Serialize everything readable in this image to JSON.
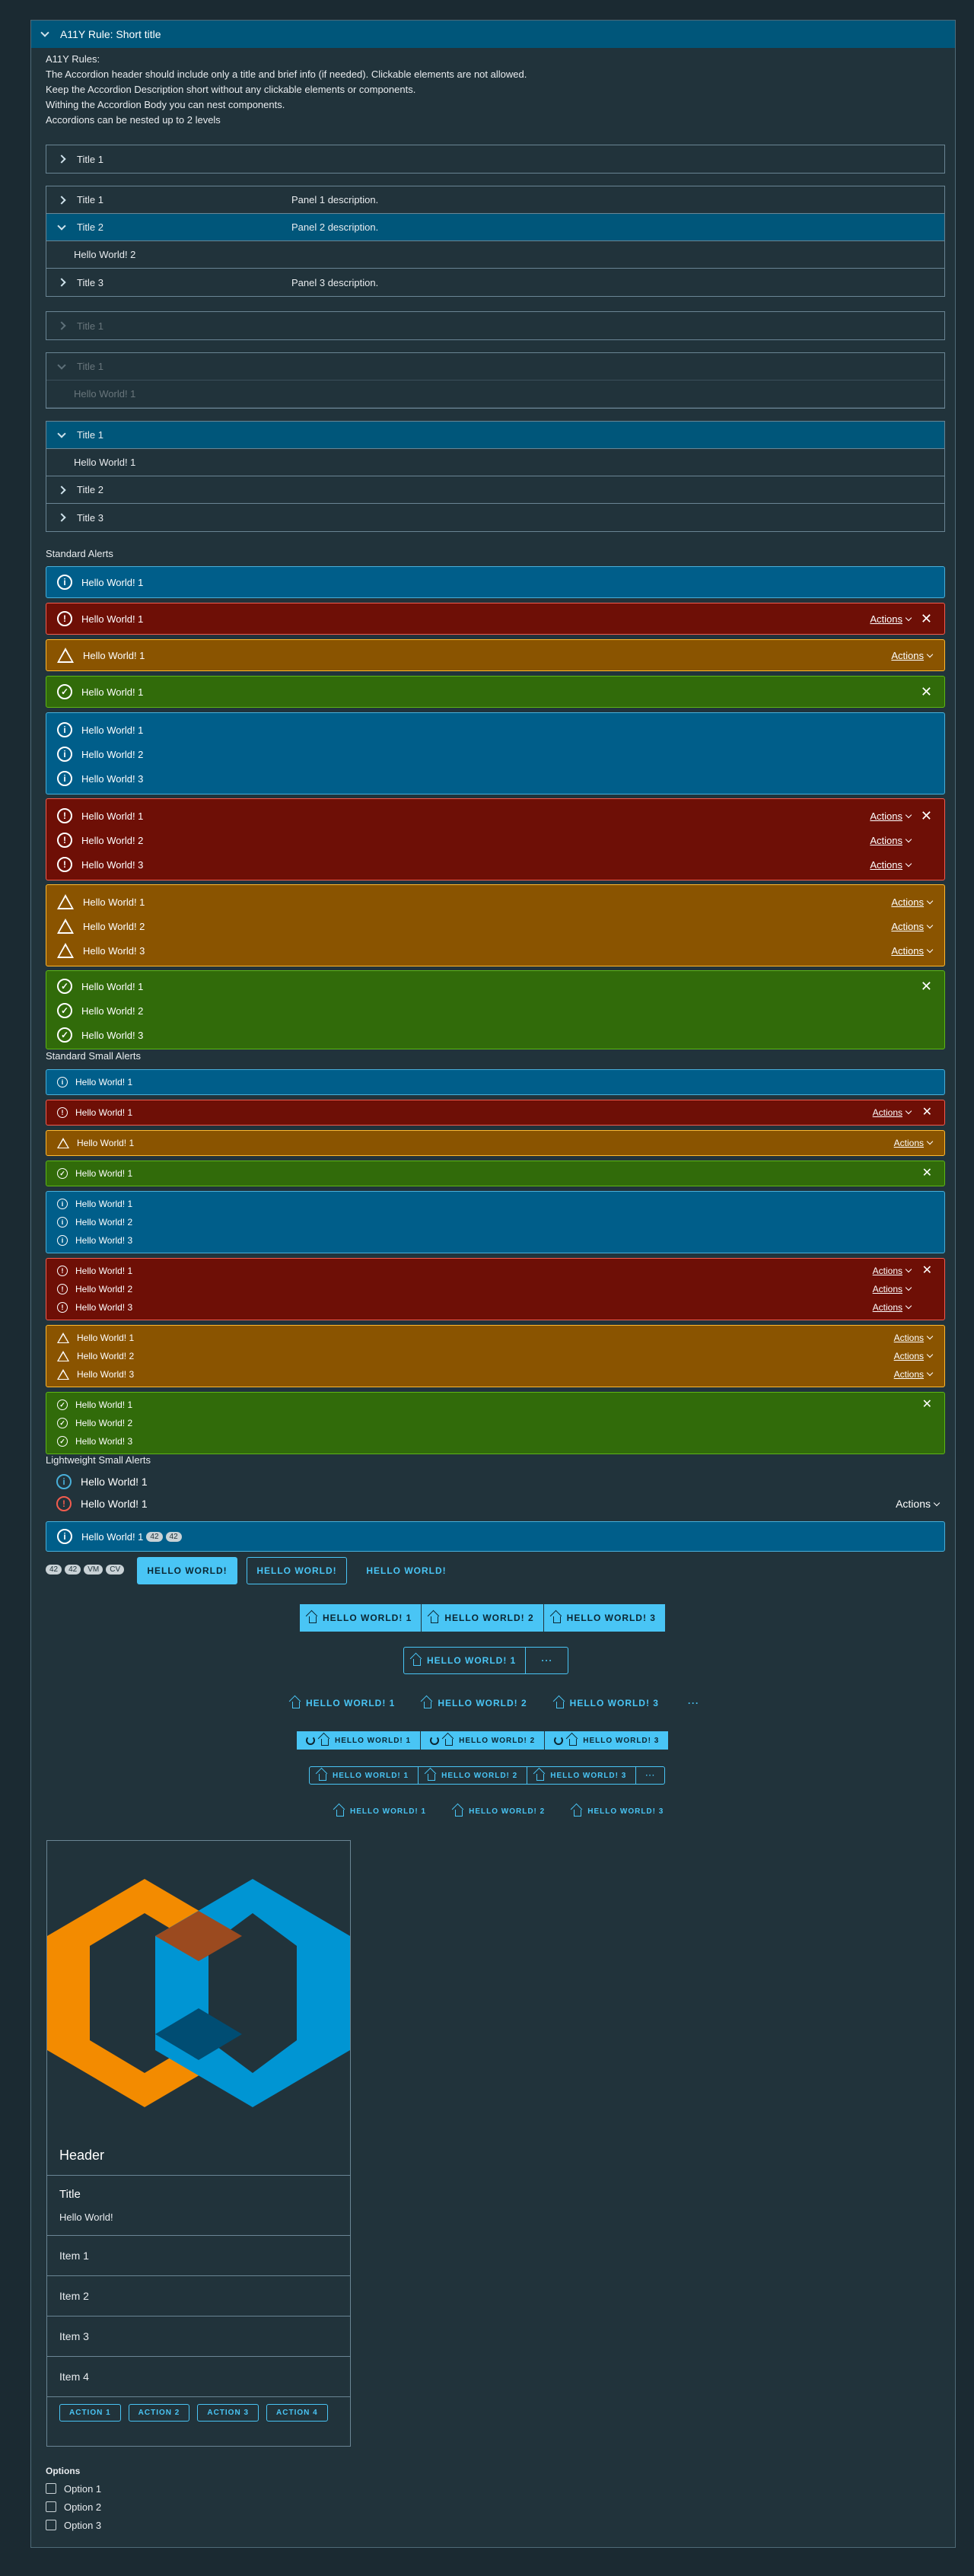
{
  "outer": {
    "title": "A11Y Rule: Short title"
  },
  "rules": [
    "A11Y Rules:",
    "The Accordion header should include only a title and brief info (if needed). Clickable elements are not allowed.",
    "Keep the Accordion Description short without any clickable elements or components.",
    "Withing the Accordion Body you can nest components.",
    "Accordions can be nested up to 2 levels"
  ],
  "acc1": {
    "title": "Title 1"
  },
  "acc2": {
    "t1": "Title 1",
    "d1": "Panel 1 description.",
    "t2": "Title 2",
    "d2": "Panel 2 description.",
    "body": "Hello World! 2",
    "t3": "Title 3",
    "d3": "Panel 3 description."
  },
  "acc3": {
    "title": "Title 1"
  },
  "acc4": {
    "title": "Title 1",
    "body": "Hello World! 1"
  },
  "acc5": {
    "t1": "Title 1",
    "body": "Hello World! 1",
    "t2": "Title 2",
    "t3": "Title 3"
  },
  "sec": {
    "standard": "Standard Alerts",
    "small": "Standard Small Alerts",
    "lightweight": "Lightweight Small Alerts"
  },
  "alerts": {
    "h1": "Hello World! 1",
    "h2": "Hello World! 2",
    "h3": "Hello World! 3",
    "actions": "Actions",
    "close": "✕"
  },
  "badges": [
    "42",
    "42"
  ],
  "chips": [
    "42",
    "42",
    "VM",
    "CV"
  ],
  "buttons": {
    "primary": "HELLO WORLD!",
    "outline": "HELLO WORLD!",
    "flat": "HELLO WORLD!"
  },
  "groups": {
    "b1": "HELLO WORLD! 1",
    "b2": "HELLO WORLD! 2",
    "b3": "HELLO WORLD! 3",
    "more": "···"
  },
  "card": {
    "header": "Header",
    "title": "Title",
    "text": "Hello World!",
    "items": [
      "Item 1",
      "Item 2",
      "Item 3",
      "Item 4"
    ],
    "actions": [
      "ACTION 1",
      "ACTION 2",
      "ACTION 3",
      "ACTION 4"
    ]
  },
  "options": {
    "label": "Options",
    "items": [
      "Option 1",
      "Option 2",
      "Option 3"
    ]
  },
  "colors": {
    "info": "#005e8a",
    "danger": "#6e0f06",
    "warning": "#8a5400",
    "success": "#316b0a",
    "accent": "#49c5f5"
  }
}
